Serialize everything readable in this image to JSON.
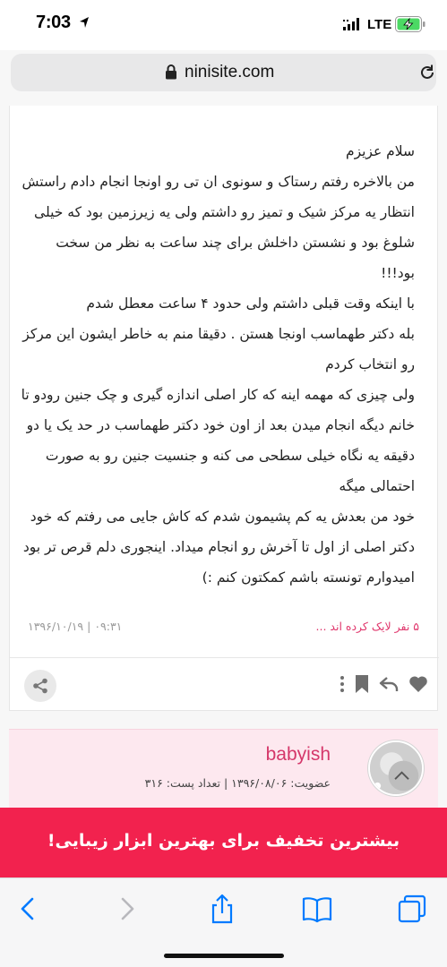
{
  "status_bar": {
    "time": "7:03",
    "network": "LTE",
    "icons": [
      "location-arrow-icon",
      "signal-icon",
      "battery-charging-icon"
    ],
    "battery_color": "#4cd964"
  },
  "browser": {
    "url": "ninisite.com",
    "icons": [
      "lock-icon",
      "reload-icon"
    ]
  },
  "post": {
    "paragraphs": [
      "سلام عزیزم",
      "من بالاخره رفتم رستاک و سونوی ان تی رو اونجا انجام دادم راستش انتظار یه مرکز شیک و تمیز رو داشتم ولی یه زیرزمین بود که خیلی شلوغ بود و نشستن داخلش برای چند ساعت به نظر من سخت بود!!!",
      "با اینکه وقت قبلی داشتم ولی حدود ۴ ساعت معطل شدم",
      "بله دکتر طهماسب اونجا هستن . دقیقا منم به خاطر ایشون این مرکز رو انتخاب کردم",
      "ولی چیزی که مهمه اینه که کار اصلی اندازه گیری و چک جنین رودو تا خانم دیگه انجام میدن بعد از اون خود دکتر طهماسب در حد یک یا دو دقیقه یه نگاه خیلی سطحی می کنه و جنسیت جنین رو به صورت احتمالی میگه",
      "خود من بعدش یه کم پشیمون شدم که کاش جایی می رفتم که خود دکتر اصلی از اول تا آخرش رو انجام میداد. اینجوری دلم قرص تر بود",
      "امیدوارم تونسته باشم کمکتون کنم :)"
    ],
    "likes_text": "۵ نفر لایک کرده اند ...",
    "date": "۰۹:۳۱ | ۱۳۹۶/۱۰/۱۹",
    "actions": [
      "heart-icon",
      "reply-icon",
      "bookmark-icon",
      "more-icon",
      "share-icon"
    ],
    "accent_color": "#e0366c"
  },
  "user_card": {
    "username": "babyish",
    "stats": "عضویت: ۱۳۹۶/۰۸/۰۶ | تعداد پست: ۳۱۶",
    "background": "#fde8ef"
  },
  "promo": {
    "text": "بیشترین تخفیف برای بهترین ابزار زیبایی!",
    "background": "#f2224e"
  },
  "toolbar": {
    "icons": [
      "back-icon",
      "forward-icon",
      "share-icon",
      "bookmarks-icon",
      "tabs-icon"
    ],
    "tint": "#007aff"
  }
}
